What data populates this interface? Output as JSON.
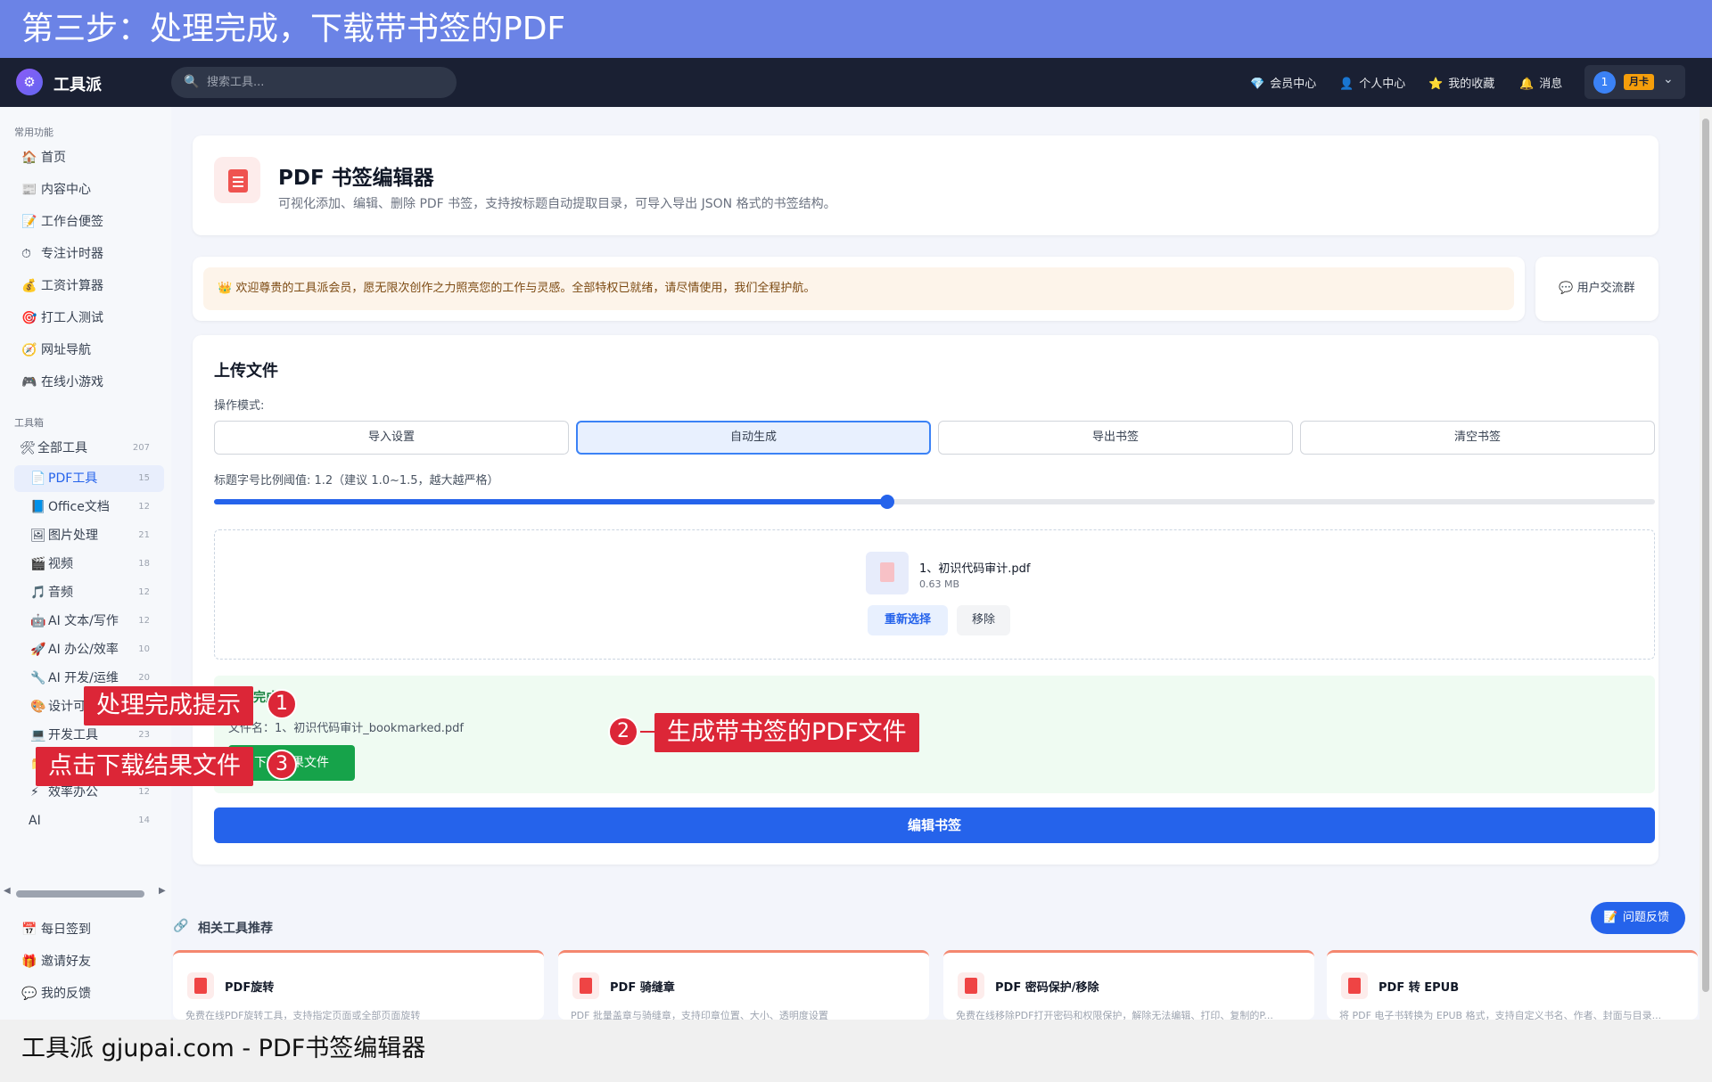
{
  "banner": {
    "text": "第三步：处理完成，下载带书签的PDF"
  },
  "topbar": {
    "brand": "工具派",
    "search_placeholder": "搜索工具...",
    "nav": [
      {
        "icon": "diamond-icon",
        "glyph": "💎",
        "label": "会员中心"
      },
      {
        "icon": "user-icon",
        "glyph": "👤",
        "label": "个人中心"
      },
      {
        "icon": "star-icon",
        "glyph": "⭐",
        "label": "我的收藏"
      },
      {
        "icon": "bell-icon",
        "glyph": "🔔",
        "label": "消息"
      }
    ],
    "user": {
      "avatar": "1",
      "badge": "月卡"
    }
  },
  "sidebar": {
    "common_title": "常用功能",
    "common": [
      {
        "glyph": "🏠",
        "label": "首页"
      },
      {
        "glyph": "📰",
        "label": "内容中心"
      },
      {
        "glyph": "📝",
        "label": "工作台便签"
      },
      {
        "glyph": "⏱",
        "label": "专注计时器"
      },
      {
        "glyph": "💰",
        "label": "工资计算器"
      },
      {
        "glyph": "🎯",
        "label": "打工人测试"
      },
      {
        "glyph": "🧭",
        "label": "网址导航"
      },
      {
        "glyph": "🎮",
        "label": "在线小游戏"
      }
    ],
    "toolbox_title": "工具箱",
    "tools": [
      {
        "glyph": "🛠",
        "label": "全部工具",
        "count": "207"
      },
      {
        "glyph": "📄",
        "label": "PDF工具",
        "count": "15"
      },
      {
        "glyph": "📘",
        "label": "Office文档",
        "count": "12"
      },
      {
        "glyph": "🖼",
        "label": "图片处理",
        "count": "21"
      },
      {
        "glyph": "🎬",
        "label": "视频",
        "count": "18"
      },
      {
        "glyph": "🎵",
        "label": "音频",
        "count": "12"
      },
      {
        "glyph": "🤖",
        "label": "AI 文本/写作",
        "count": "12"
      },
      {
        "glyph": "🚀",
        "label": "AI 办公/效率",
        "count": "10"
      },
      {
        "glyph": "🔧",
        "label": "AI 开发/运维",
        "count": "20"
      },
      {
        "glyph": "🎨",
        "label": "设计可",
        "count": ""
      },
      {
        "glyph": "💻",
        "label": "开发工具",
        "count": "23"
      },
      {
        "glyph": "📁",
        "label": "",
        "count": ""
      },
      {
        "glyph": "⚡",
        "label": "效率办公",
        "count": "12"
      },
      {
        "glyph": "",
        "label": "AI",
        "count": "14"
      }
    ],
    "bottom": [
      {
        "glyph": "📅",
        "label": "每日签到"
      },
      {
        "glyph": "🎁",
        "label": "邀请好友"
      },
      {
        "glyph": "💬",
        "label": "我的反馈"
      }
    ]
  },
  "header_card": {
    "title": "PDF 书签编辑器",
    "description": "可视化添加、编辑、删除 PDF 书签，支持按标题自动提取目录，可导入导出 JSON 格式的书签结构。"
  },
  "notice": {
    "text": "👑 欢迎尊贵的工具派会员，愿无限次创作之力照亮您的工作与灵感。全部特权已就绪，请尽情使用，我们全程护航。",
    "group_button": "用户交流群"
  },
  "upload": {
    "title": "上传文件",
    "mode_label": "操作模式:",
    "modes": [
      "导入设置",
      "自动生成",
      "导出书签",
      "清空书签"
    ],
    "active_mode": "自动生成",
    "threshold_label": "标题字号比例阈值: 1.2（建议 1.0~1.5，越大越严格）",
    "threshold_fraction": 0.467,
    "file": {
      "name": "1、初识代码审计.pdf",
      "size": "0.63 MB"
    },
    "reselect": "重新选择",
    "remove": "移除"
  },
  "result": {
    "title": "处理完成",
    "file_line": "文件名：1、初识代码审计_bookmarked.pdf",
    "download": "下载结果文件",
    "edit_button": "编辑书签"
  },
  "recommend": {
    "title": "相关工具推荐",
    "feedback": "问题反馈",
    "items": [
      {
        "name": "PDF旋转",
        "desc": "免费在线PDF旋转工具，支持指定页面或全部页面旋转"
      },
      {
        "name": "PDF 骑缝章",
        "desc": "PDF 批量盖章与骑缝章，支持印章位置、大小、透明度设置"
      },
      {
        "name": "PDF 密码保护/移除",
        "desc": "免费在线移除PDF打开密码和权限保护，解除无法编辑、打印、复制的P..."
      },
      {
        "name": "PDF 转 EPUB",
        "desc": "将 PDF 电子书转换为 EPUB 格式，支持自定义书名、作者、封面与目录..."
      }
    ]
  },
  "annotations": [
    {
      "number": "1",
      "text": "处理完成提示"
    },
    {
      "number": "2",
      "text": "生成带书签的PDF文件"
    },
    {
      "number": "3",
      "text": "点击下载结果文件"
    }
  ],
  "footer": {
    "text": "工具派 gjupai.com - PDF书签编辑器"
  },
  "colors": {
    "accent": "#2563eb",
    "banner": "#6b83e6",
    "annotation": "#dc2637",
    "success": "#16a34a"
  }
}
